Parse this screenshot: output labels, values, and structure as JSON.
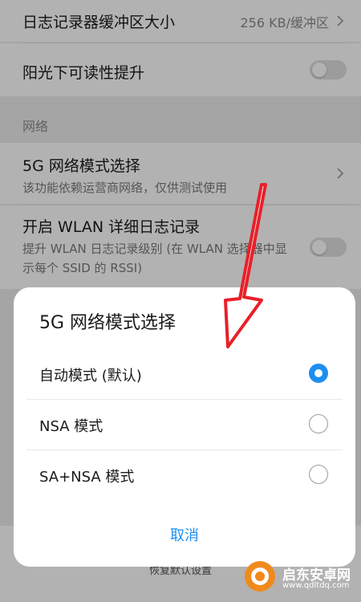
{
  "settings": {
    "log_buffer": {
      "label": "日志记录器缓冲区大小",
      "value": "256 KB/缓冲区"
    },
    "sunlight": {
      "label": "阳光下可读性提升"
    },
    "section_network": "网络",
    "fiveg_mode": {
      "label": "5G 网络模式选择",
      "subtitle": "该功能依赖运营商网络，仅供测试使用"
    },
    "wlan_log": {
      "label": "开启 WLAN 详细日志记录",
      "subtitle": "提升 WLAN 日志记录级别 (在 WLAN 选择器中显示每个 SSID 的 RSSI)"
    },
    "reset_defaults": "恢复默认设置"
  },
  "dialog": {
    "title": "5G 网络模式选择",
    "options": [
      {
        "label": "自动模式 (默认)",
        "selected": true
      },
      {
        "label": "NSA 模式",
        "selected": false
      },
      {
        "label": "SA+NSA 模式",
        "selected": false
      }
    ],
    "cancel": "取消"
  },
  "watermark": {
    "text": "启东安卓网",
    "url": "www.qdltdq.com"
  },
  "colors": {
    "accent": "#1e8ef0",
    "annotation_arrow": "#e8202a"
  }
}
